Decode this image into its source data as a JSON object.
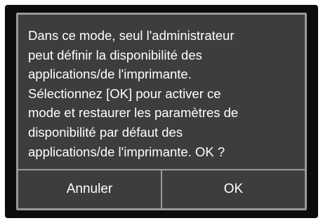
{
  "dialog": {
    "message": "Dans ce mode, seul l'administrateur\npeut définir la disponibilité des\napplications/de l'imprimante.\nSélectionnez [OK] pour activer ce\nmode et restaurer les paramètres de\ndisponibilité par défaut des\napplications/de l'imprimante. OK ?",
    "cancel_label": "Annuler",
    "ok_label": "OK"
  },
  "colors": {
    "screen_background": "#0c0c0c",
    "dialog_background": "#3d3d3b",
    "dialog_border": "#9a9a9a",
    "text": "#ffffff"
  }
}
